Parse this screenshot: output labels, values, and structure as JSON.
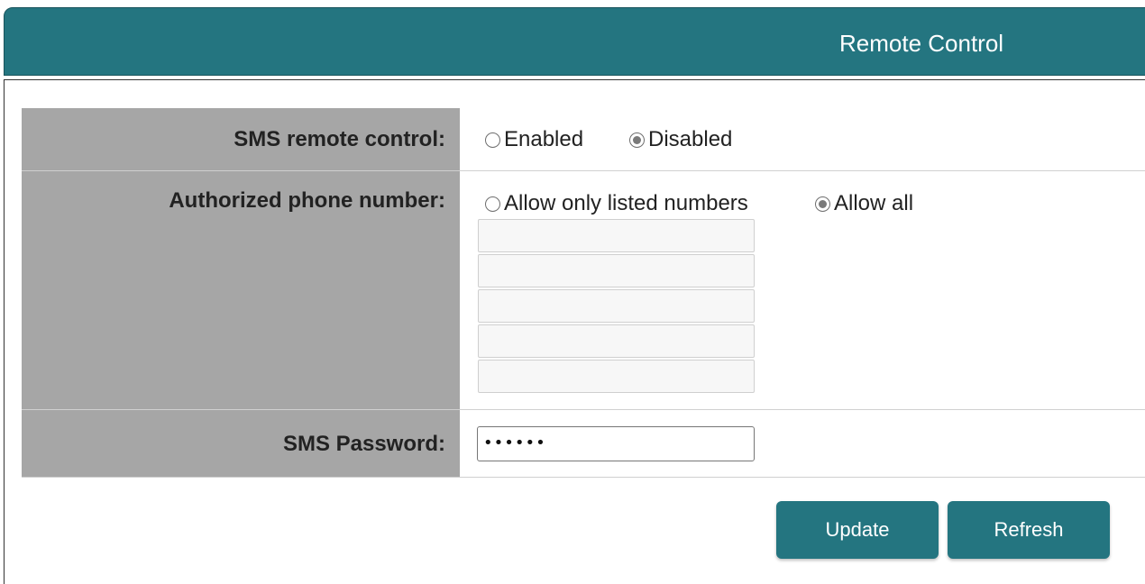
{
  "header": {
    "title": "Remote Control"
  },
  "sms_remote_control": {
    "label": "SMS remote control:",
    "options": [
      {
        "label": "Enabled",
        "checked": false
      },
      {
        "label": "Disabled",
        "checked": true
      }
    ]
  },
  "authorized_phone": {
    "label": "Authorized phone number:",
    "options": [
      {
        "label": "Allow only listed numbers",
        "checked": false
      },
      {
        "label": "Allow all",
        "checked": true
      }
    ],
    "numbers": [
      "",
      "",
      "",
      "",
      ""
    ]
  },
  "sms_password": {
    "label": "SMS Password:",
    "value": "••••••"
  },
  "buttons": {
    "update": "Update",
    "refresh": "Refresh"
  },
  "colors": {
    "accent": "#247580",
    "label_bg": "#a6a6a6"
  }
}
